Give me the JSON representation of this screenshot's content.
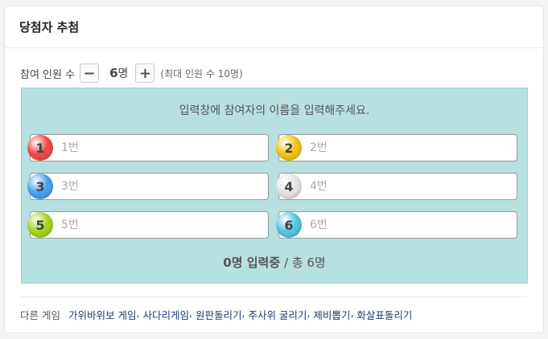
{
  "card": {
    "title": "당첨자 추첨"
  },
  "count": {
    "label": "참여 인원 수",
    "minus_label": "−",
    "plus_label": "+",
    "number": "6",
    "unit": "명",
    "max_text": "(최대 인원 수 10명)"
  },
  "panel": {
    "instruction": "입력창에 참여자의 이름을 입력해주세요.",
    "entries": [
      {
        "number": "1",
        "placeholder": "1번",
        "value": "",
        "color": "#ef4b4b"
      },
      {
        "number": "2",
        "placeholder": "2번",
        "value": "",
        "color": "#f5c415"
      },
      {
        "number": "3",
        "placeholder": "3번",
        "value": "",
        "color": "#4aa3f0"
      },
      {
        "number": "4",
        "placeholder": "4번",
        "value": "",
        "color": "#e4e4e4"
      },
      {
        "number": "5",
        "placeholder": "5번",
        "value": "",
        "color": "#a6d422"
      },
      {
        "number": "6",
        "placeholder": "6번",
        "value": "",
        "color": "#54c7e2"
      }
    ],
    "status_count": "0명 입력중",
    "status_total": " / 총 6명"
  },
  "games": {
    "label": "다른 게임",
    "links": [
      "가위바위보 게임",
      "사다리게임",
      "원판돌리기",
      "주사위 굴리기",
      "제비뽑기",
      "화살표돌리기"
    ]
  },
  "colors": {
    "panel_bg": "#b7e0e0",
    "link": "#1a3a75"
  }
}
